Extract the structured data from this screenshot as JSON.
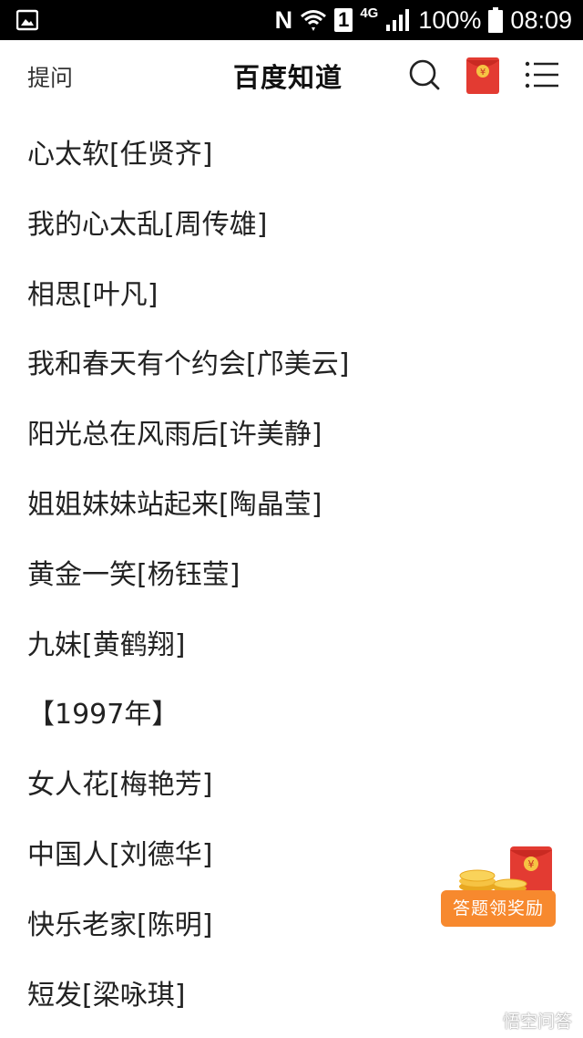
{
  "status_bar": {
    "battery_percent": "100%",
    "time": "08:09",
    "network": "4G",
    "sim_slot": "1",
    "nfc": "N"
  },
  "header": {
    "ask_label": "提问",
    "title": "百度知道",
    "redpack_symbol": "¥"
  },
  "songs": [
    "心太软[任贤齐]",
    "我的心太乱[周传雄]",
    "相思[叶凡]",
    "我和春天有个约会[邝美云]",
    "阳光总在风雨后[许美静]",
    "姐姐妹妹站起来[陶晶莹]",
    "黄金一笑[杨钰莹]",
    "九妹[黄鹤翔]",
    "【1997年】",
    "女人花[梅艳芳]",
    "中国人[刘德华]",
    "快乐老家[陈明]",
    "短发[梁咏琪]"
  ],
  "reward": {
    "label": "答题领奖励",
    "symbol": "¥"
  },
  "watermark": "悟空问答",
  "colors": {
    "status_bar_bg": "#000000",
    "reward_orange": "#f7892e",
    "redpack_red": "#e33b32"
  }
}
